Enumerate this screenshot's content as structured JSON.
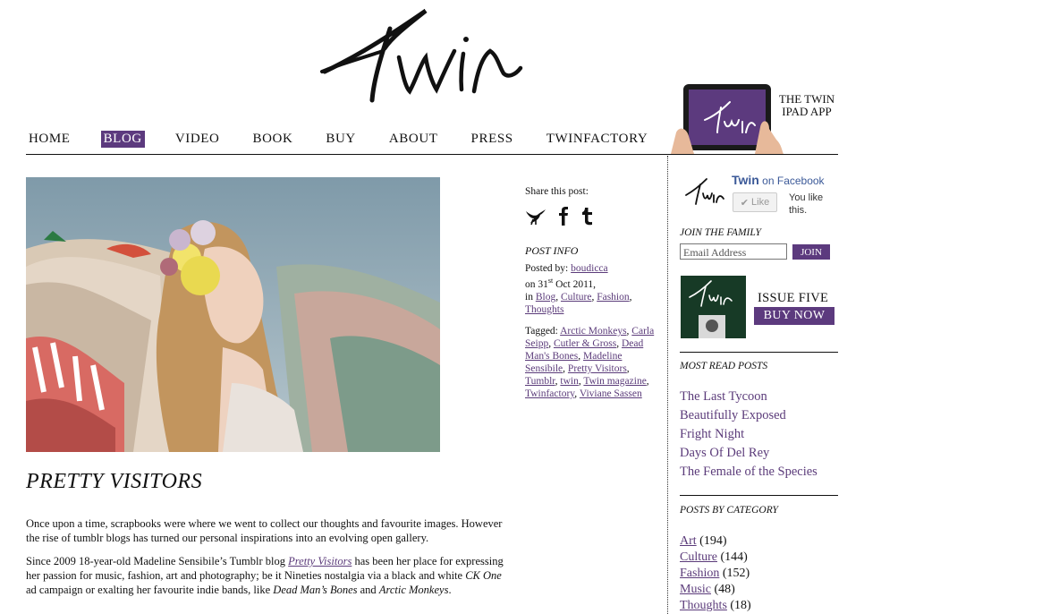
{
  "logo": {
    "text": "Twin"
  },
  "nav": {
    "items": [
      "HOME",
      "BLOG",
      "VIDEO",
      "BOOK",
      "BUY",
      "ABOUT",
      "PRESS",
      "TWINFACTORY"
    ],
    "active": "BLOG"
  },
  "ipad_promo": {
    "line1": "THE TWIN",
    "line2": "IPAD APP"
  },
  "post": {
    "title": "PRETTY VISITORS",
    "p1": "Once upon a time, scrapbooks were where we went to collect our thoughts and favourite images. However the rise of tumblr blogs has turned our personal inspirations into an evolving open gallery.",
    "p2_a": "Since 2009 18-year-old Madeline Sensibile’s Tumblr blog ",
    "p2_link": "Pretty Visitors",
    "p2_b": " has been her place for expressing her passion for music, fashion, art and photography; be it Nineties nostalgia via a black and white ",
    "p2_em1": "CK One",
    "p2_c": " ad campaign or exalting her favourite indie bands, like ",
    "p2_em2": "Dead Man’s Bones",
    "p2_d": " and ",
    "p2_em3": "Arctic Monkeys",
    "p2_e": "."
  },
  "share": {
    "label": "Share this post:"
  },
  "post_info": {
    "heading": "POST INFO",
    "posted_by_label": "Posted by: ",
    "author": "boudicca",
    "date_prefix": "on 31",
    "date_sup": "st",
    "date_suffix": " Oct 2011,",
    "in_label": "in ",
    "categories": [
      "Blog",
      "Culture",
      "Fashion",
      "Thoughts"
    ],
    "tagged_label": "Tagged: ",
    "tags": [
      "Arctic Monkeys",
      "Carla Seipp",
      "Cutler & Gross",
      "Dead Man's Bones",
      "Madeline Sensibile",
      "Pretty Visitors",
      "Tumblr",
      "twin",
      "Twin magazine",
      "Twinfactory",
      "Viviane Sassen"
    ]
  },
  "sidebar": {
    "fb": {
      "name": "Twin",
      "suffix": " on Facebook",
      "like": "Like",
      "you_like": "You like this."
    },
    "join": {
      "heading": "JOIN THE FAMILY",
      "placeholder": "Email Address",
      "button": "JOIN"
    },
    "issue": {
      "label": "ISSUE FIVE",
      "button": "BUY NOW"
    },
    "most_read": {
      "heading": "MOST READ POSTS",
      "items": [
        "The Last Tycoon",
        "Beautifully Exposed",
        "Fright Night",
        "Days Of Del Rey",
        "The Female of the Species"
      ]
    },
    "categories": {
      "heading": "POSTS BY CATEGORY",
      "items": [
        {
          "name": "Art",
          "count": "(194)"
        },
        {
          "name": "Culture",
          "count": "(144)"
        },
        {
          "name": "Fashion",
          "count": "(152)"
        },
        {
          "name": "Music",
          "count": "(48)"
        },
        {
          "name": "Thoughts",
          "count": "(18)"
        }
      ]
    }
  },
  "colors": {
    "accent": "#5c3a7e",
    "link": "#5b3b7a",
    "fb": "#3b5998"
  }
}
